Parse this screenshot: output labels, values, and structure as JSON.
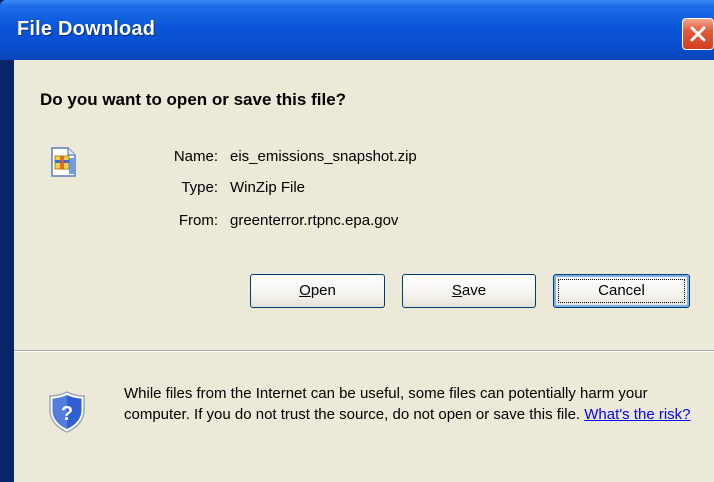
{
  "window": {
    "title": "File Download"
  },
  "dialog": {
    "question": "Do you want to open or save this file?",
    "file": {
      "icon": "winzip-file-icon",
      "name_label": "Name:",
      "name_value": "eis_emissions_snapshot.zip",
      "type_label": "Type:",
      "type_value": "WinZip File",
      "from_label": "From:",
      "from_value": "greenterror.rtpnc.epa.gov"
    },
    "buttons": {
      "open_prefix": "",
      "open_mnemonic": "O",
      "open_rest": "pen",
      "save_prefix": "",
      "save_mnemonic": "S",
      "save_rest": "ave",
      "cancel_label": "Cancel"
    },
    "warning": {
      "icon": "security-shield-question-icon",
      "text": "While files from the Internet can be useful, some files can potentially harm your computer. If you do not trust the source, do not open or save this file.",
      "link_text": "What's the risk?"
    }
  },
  "colors": {
    "titlebar": "#0a55d8",
    "client_bg": "#ece9d8",
    "close_button": "#e2593a",
    "link": "#0000ff"
  }
}
